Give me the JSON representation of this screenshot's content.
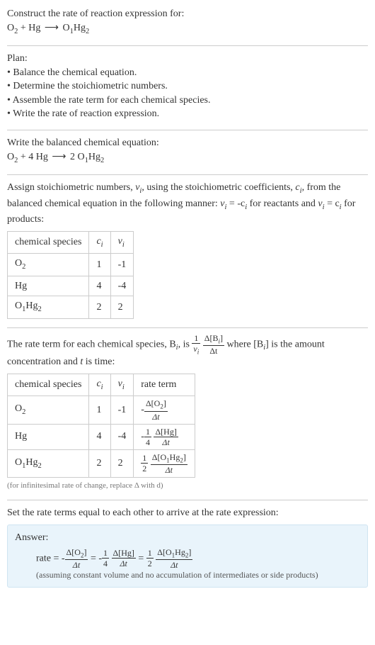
{
  "header": {
    "construct": "Construct the rate of reaction expression for:",
    "equation_o2": "O",
    "equation_hg": " + Hg ",
    "equation_arrow": "⟶",
    "equation_prod": " O",
    "equation_ohg_sub1": "1",
    "equation_ohg_sub2": "Hg",
    "sub2": "2"
  },
  "plan": {
    "title": "Plan:",
    "item1": "• Balance the chemical equation.",
    "item2": "• Determine the stoichiometric numbers.",
    "item3": "• Assemble the rate term for each chemical species.",
    "item4": "• Write the rate of reaction expression."
  },
  "balanced": {
    "title": "Write the balanced chemical equation:",
    "o2": "O",
    "plus4hg": " + 4 Hg ",
    "arrow": "⟶",
    "two": " 2 O",
    "sub1": "1",
    "hg": "Hg",
    "sub2": "2"
  },
  "stoich_text": {
    "pre": "Assign stoichiometric numbers, ",
    "nu": "ν",
    "i": "i",
    "mid1": ", using the stoichiometric coefficients, ",
    "c": "c",
    "mid2": ", from the balanced chemical equation in the following manner: ",
    "eq1a": "ν",
    "eq1b": " = -c",
    "mid3": " for reactants and ",
    "eq2a": "ν",
    "eq2b": " = c",
    "mid4": " for products:"
  },
  "stoich_table": {
    "h1": "chemical species",
    "h2": "c",
    "h3": "ν",
    "hi": "i",
    "r1c1": "O",
    "r1sub": "2",
    "r1c2": "1",
    "r1c3": "-1",
    "r2c1": "Hg",
    "r2c2": "4",
    "r2c3": "-4",
    "r3c1": "O",
    "r3sub1": "1",
    "r3hg": "Hg",
    "r3sub2": "2",
    "r3c2": "2",
    "r3c3": "2"
  },
  "rate_term_text": {
    "pre": "The rate term for each chemical species, B",
    "i": "i",
    "mid1": ", is ",
    "one": "1",
    "nu": "ν",
    "dB": "Δ[B",
    "dBend": "]",
    "dt": "Δt",
    "mid2": " where [B",
    "mid3": "] is the amount concentration and ",
    "t": "t",
    "mid4": " is time:"
  },
  "rate_table": {
    "h1": "chemical species",
    "h2": "c",
    "h3": "ν",
    "h4": "rate term",
    "hi": "i",
    "r1c1": "O",
    "r1sub": "2",
    "r1c2": "1",
    "r1c3": "-1",
    "r1_neg": "-",
    "r1_dnum": "Δ[O",
    "r1_d2": "2",
    "r1_dend": "]",
    "r1_dt": "Δt",
    "r2c1": "Hg",
    "r2c2": "4",
    "r2c3": "-4",
    "r2_neg": "-",
    "r2_f1": "1",
    "r2_f4": "4",
    "r2_dnum": "Δ[Hg]",
    "r2_dt": "Δt",
    "r3c1": "O",
    "r3sub1": "1",
    "r3hg": "Hg",
    "r3sub2": "2",
    "r3c2": "2",
    "r3c3": "2",
    "r3_f1": "1",
    "r3_f2": "2",
    "r3_dnum": "Δ[O",
    "r3_d1": "1",
    "r3_dhg": "Hg",
    "r3_d2": "2",
    "r3_dend": "]",
    "r3_dt": "Δt"
  },
  "note": "(for infinitesimal rate of change, replace Δ with d)",
  "final_text": "Set the rate terms equal to each other to arrive at the rate expression:",
  "answer": {
    "label": "Answer:",
    "rate": "rate = -",
    "dnum1": "Δ[O",
    "d2": "2",
    "dend": "]",
    "dt": "Δt",
    "eq": " = -",
    "f1": "1",
    "f4": "4",
    "dnum2": "Δ[Hg]",
    "eq2": " = ",
    "f2": "2",
    "dnum3": "Δ[O",
    "d1": "1",
    "dhg": "Hg",
    "note": "(assuming constant volume and no accumulation of intermediates or side products)"
  }
}
